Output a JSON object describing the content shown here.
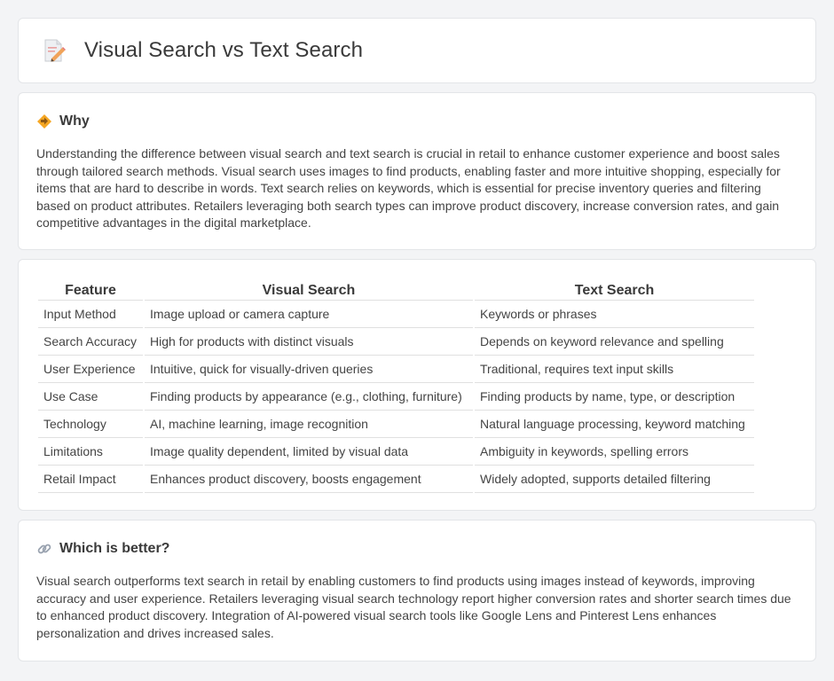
{
  "header": {
    "title": "Visual Search vs Text Search",
    "icon": "document-pencil-icon"
  },
  "why": {
    "heading": "Why",
    "icon": "diamond-arrow-icon",
    "body": "Understanding the difference between visual search and text search is crucial in retail to enhance customer experience and boost sales through tailored search methods. Visual search uses images to find products, enabling faster and more intuitive shopping, especially for items that are hard to describe in words. Text search relies on keywords, which is essential for precise inventory queries and filtering based on product attributes. Retailers leveraging both search types can improve product discovery, increase conversion rates, and gain competitive advantages in the digital marketplace."
  },
  "comparison": {
    "headers": [
      "Feature",
      "Visual Search",
      "Text Search"
    ],
    "rows": [
      [
        "Input Method",
        "Image upload or camera capture",
        "Keywords or phrases"
      ],
      [
        "Search Accuracy",
        "High for products with distinct visuals",
        "Depends on keyword relevance and spelling"
      ],
      [
        "User Experience",
        "Intuitive, quick for visually-driven queries",
        "Traditional, requires text input skills"
      ],
      [
        "Use Case",
        "Finding products by appearance (e.g., clothing, furniture)",
        "Finding products by name, type, or description"
      ],
      [
        "Technology",
        "AI, machine learning, image recognition",
        "Natural language processing, keyword matching"
      ],
      [
        "Limitations",
        "Image quality dependent, limited by visual data",
        "Ambiguity in keywords, spelling errors"
      ],
      [
        "Retail Impact",
        "Enhances product discovery, boosts engagement",
        "Widely adopted, supports detailed filtering"
      ]
    ]
  },
  "better": {
    "heading": "Which is better?",
    "icon": "link-icon",
    "body": "Visual search outperforms text search in retail by enabling customers to find products using images instead of keywords, improving accuracy and user experience. Retailers leveraging visual search technology report higher conversion rates and shorter search times due to enhanced product discovery. Integration of AI-powered visual search tools like Google Lens and Pinterest Lens enhances personalization and drives increased sales."
  }
}
